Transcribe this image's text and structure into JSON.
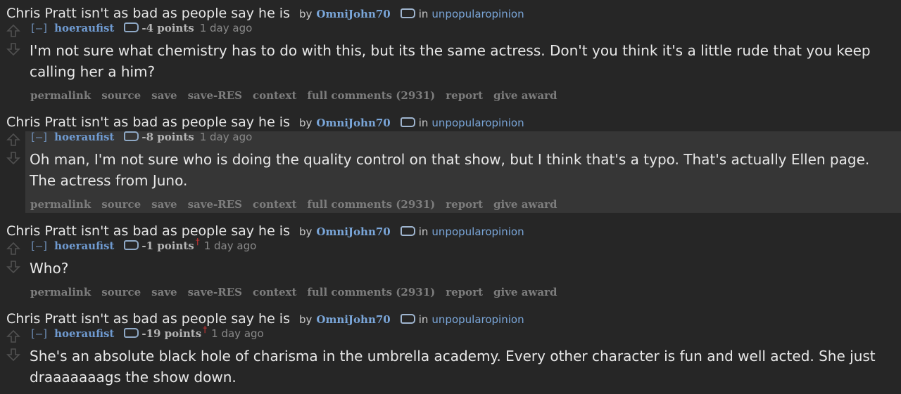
{
  "entries": [
    {
      "post_title": "Chris Pratt isn't as bad as people say he is",
      "by": "by",
      "author": "OmniJohn70",
      "in": "in",
      "subreddit": "unpopularopinion",
      "collapse": "[–]",
      "username": "hoeraufist",
      "score": "-4 points",
      "controversial": "",
      "time": "1 day ago",
      "body": "I'm not sure what chemistry has to do with this, but its the same actress. Don't you think it's a little rude that you keep calling her a him?",
      "buttons": [
        "permalink",
        "source",
        "save",
        "save-RES",
        "context",
        "full comments (2931)",
        "report",
        "give award"
      ]
    },
    {
      "post_title": "Chris Pratt isn't as bad as people say he is",
      "by": "by",
      "author": "OmniJohn70",
      "in": "in",
      "subreddit": "unpopularopinion",
      "collapse": "[–]",
      "username": "hoeraufist",
      "score": "-8 points",
      "controversial": "",
      "time": "1 day ago",
      "body": "Oh man, I'm not sure who is doing the quality control on that show, but I think that's a typo. That's actually Ellen page. The actress from Juno.",
      "buttons": [
        "permalink",
        "source",
        "save",
        "save-RES",
        "context",
        "full comments (2931)",
        "report",
        "give award"
      ]
    },
    {
      "post_title": "Chris Pratt isn't as bad as people say he is",
      "by": "by",
      "author": "OmniJohn70",
      "in": "in",
      "subreddit": "unpopularopinion",
      "collapse": "[–]",
      "username": "hoeraufist",
      "score": "-1 points",
      "controversial": "†",
      "time": "1 day ago",
      "body": "Who?",
      "buttons": [
        "permalink",
        "source",
        "save",
        "save-RES",
        "context",
        "full comments (2931)",
        "report",
        "give award"
      ]
    },
    {
      "post_title": "Chris Pratt isn't as bad as people say he is",
      "by": "by",
      "author": "OmniJohn70",
      "in": "in",
      "subreddit": "unpopularopinion",
      "collapse": "[–]",
      "username": "hoeraufist",
      "score": "-19 points",
      "controversial": "†",
      "time": "1 day ago",
      "body": "She's an absolute black hole of charisma in the umbrella academy. Every other character is fun and well acted. She just draaaaaaags the show down.",
      "buttons": []
    }
  ],
  "icons": {
    "upvote": "upvote-arrow-icon",
    "downvote": "downvote-arrow-icon",
    "flair": "tag-icon"
  }
}
